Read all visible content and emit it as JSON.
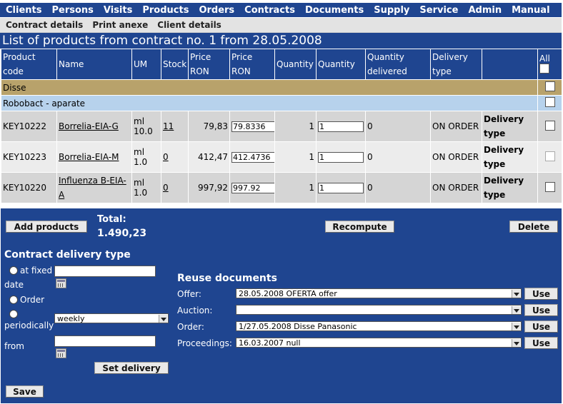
{
  "menu": [
    "Clients",
    "Persons",
    "Visits",
    "Products",
    "Orders",
    "Contracts",
    "Documents",
    "Supply",
    "Service",
    "Admin",
    "Manual"
  ],
  "submenu": [
    "Contract details",
    "Print anexe",
    "Client details"
  ],
  "title": "List of products from contract no.  1 from  28.05.2008",
  "headers": {
    "code": "Product code",
    "name": "Name",
    "um": "UM",
    "stock": "Stock",
    "price1": "Price RON",
    "price2": "Price RON",
    "qty1": "Quantity",
    "qty2": "Quantity",
    "delivered": "Quantity delivered",
    "dtype": "Delivery type",
    "extra": "",
    "all": "All"
  },
  "groups": {
    "g1": "Disse",
    "g2": "Robobact - aparate"
  },
  "rows": [
    {
      "code": "KEY10222",
      "name": "Borrelia-EIA-G",
      "um": "ml 10.0",
      "stock": "11",
      "price": "79,83",
      "price_input": "79.8336",
      "qty": "1",
      "qty_input": "1",
      "delivered": "0",
      "status": "ON ORDER",
      "dtype_label": "Delivery type"
    },
    {
      "code": "KEY10223",
      "name": "Borrelia-EIA-M",
      "um": "ml 1.0",
      "stock": "0",
      "price": "412,47",
      "price_input": "412.4736",
      "qty": "1",
      "qty_input": "1",
      "delivered": "0",
      "status": "ON ORDER",
      "dtype_label": "Delivery type"
    },
    {
      "code": "KEY10220",
      "name": "Influenza B-EIA-A",
      "um": "ml 1.0",
      "stock": "0",
      "price": "997,92",
      "price_input": "997.92",
      "qty": "1",
      "qty_input": "1",
      "delivered": "0",
      "status": "ON ORDER",
      "dtype_label": "Delivery type"
    }
  ],
  "actions": {
    "add": "Add products",
    "total_label": "Total:",
    "total_value": "1.490,23",
    "recompute": "Recompute",
    "delete": "Delete"
  },
  "delivery": {
    "heading": "Contract delivery type",
    "fixed_label1": "at fixed",
    "fixed_label2": "date",
    "order_label": "Order",
    "periodic_label": "periodically",
    "periodic_value": "weekly",
    "from_label": "from",
    "set_button": "Set delivery"
  },
  "reuse": {
    "heading": "Reuse documents",
    "offer_label": "Offer:",
    "offer_value": "28.05.2008 OFERTA offer",
    "auction_label": "Auction:",
    "auction_value": "",
    "order_label": "Order:",
    "order_value": "1/27.05.2008 Disse Panasonic",
    "proceedings_label": "Proceedings:",
    "proceedings_value": "16.03.2007 null",
    "use_label": "Use"
  },
  "save": "Save",
  "colors": {
    "navy": "#1f4590",
    "group1": "#b8a26b",
    "group2": "#b7d2ec",
    "row_dark": "#d5d5d5",
    "row_light": "#ececec"
  }
}
